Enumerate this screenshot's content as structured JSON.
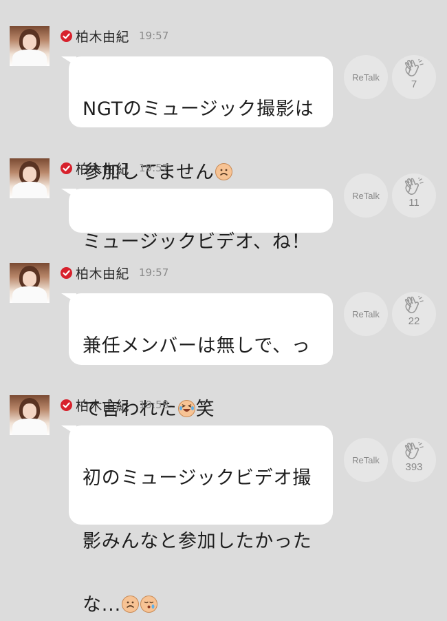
{
  "colors": {
    "background": "#dcdcdc",
    "bubble": "#ffffff",
    "verified": "#d7212c",
    "muted_text": "#8a8a8a"
  },
  "messages": [
    {
      "author": "柏木由紀",
      "time": "19:57",
      "text_lines": [
        "NGTのミュージック撮影は",
        "参加してません"
      ],
      "emoji": [
        "frowning-face"
      ],
      "retalk_label": "ReTalk",
      "clap_count": "7"
    },
    {
      "author": "柏木由紀",
      "time": "19:57",
      "text_lines": [
        "ミュージックビデオ、ね！"
      ],
      "emoji": [],
      "retalk_label": "ReTalk",
      "clap_count": "11"
    },
    {
      "author": "柏木由紀",
      "time": "19:57",
      "text_lines": [
        "兼任メンバーは無しで、っ",
        "て言われた",
        "笑"
      ],
      "emoji": [
        "tears-of-joy-face"
      ],
      "retalk_label": "ReTalk",
      "clap_count": "22"
    },
    {
      "author": "柏木由紀",
      "time": "19:58",
      "text_lines": [
        "初のミュージックビデオ撮",
        "影みんなと参加したかった",
        "な..."
      ],
      "emoji": [
        "frowning-face",
        "crying-face"
      ],
      "retalk_label": "ReTalk",
      "clap_count": "393"
    }
  ]
}
